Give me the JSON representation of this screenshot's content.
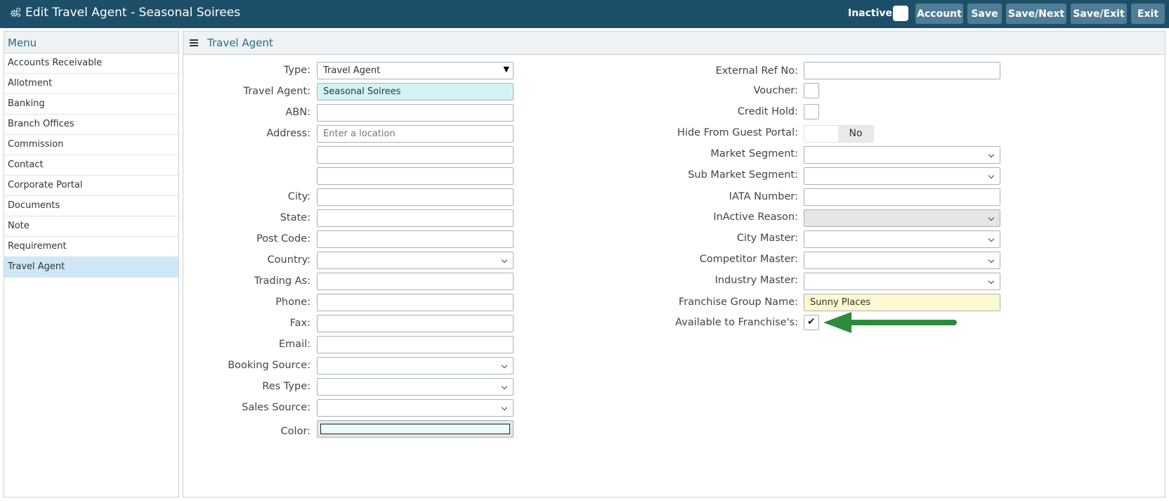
{
  "header": {
    "title": "Edit Travel Agent - Seasonal Soirees",
    "inactive_label": "Inactive",
    "buttons": {
      "account": "Account",
      "save": "Save",
      "save_next": "Save/Next",
      "save_exit": "Save/Exit",
      "exit": "Exit"
    }
  },
  "sidebar": {
    "title": "Menu",
    "items": [
      {
        "label": "Accounts Receivable"
      },
      {
        "label": "Allotment"
      },
      {
        "label": "Banking"
      },
      {
        "label": "Branch Offices"
      },
      {
        "label": "Commission"
      },
      {
        "label": "Contact"
      },
      {
        "label": "Corporate Portal"
      },
      {
        "label": "Documents"
      },
      {
        "label": "Note"
      },
      {
        "label": "Requirement"
      },
      {
        "label": "Travel Agent",
        "active": true
      }
    ]
  },
  "panel": {
    "title": "Travel Agent"
  },
  "left_form": {
    "type": {
      "label": "Type:",
      "value": "Travel Agent"
    },
    "travel_agent": {
      "label": "Travel Agent:",
      "value": "Seasonal Soirees"
    },
    "abn": {
      "label": "ABN:",
      "value": ""
    },
    "address": {
      "label": "Address:",
      "placeholder": "Enter a location"
    },
    "city": {
      "label": "City:",
      "value": ""
    },
    "state": {
      "label": "State:",
      "value": ""
    },
    "post_code": {
      "label": "Post Code:",
      "value": ""
    },
    "country": {
      "label": "Country:",
      "value": ""
    },
    "trading_as": {
      "label": "Trading As:",
      "value": ""
    },
    "phone": {
      "label": "Phone:",
      "value": ""
    },
    "fax": {
      "label": "Fax:",
      "value": ""
    },
    "email": {
      "label": "Email:",
      "value": ""
    },
    "booking_source": {
      "label": "Booking Source:",
      "value": ""
    },
    "res_type": {
      "label": "Res Type:",
      "value": ""
    },
    "sales_source": {
      "label": "Sales Source:",
      "value": ""
    },
    "color": {
      "label": "Color:",
      "value": "#ecfafa"
    }
  },
  "right_form": {
    "external_ref": {
      "label": "External Ref No:",
      "value": ""
    },
    "voucher": {
      "label": "Voucher:",
      "checked": false
    },
    "credit_hold": {
      "label": "Credit Hold:",
      "checked": false
    },
    "hide_portal": {
      "label": "Hide From Guest Portal:",
      "value": "No"
    },
    "market_segment": {
      "label": "Market Segment:",
      "value": ""
    },
    "sub_market_segment": {
      "label": "Sub Market Segment:",
      "value": ""
    },
    "iata": {
      "label": "IATA Number:",
      "value": ""
    },
    "inactive_reason": {
      "label": "InActive Reason:",
      "value": ""
    },
    "city_master": {
      "label": "City Master:",
      "value": ""
    },
    "competitor_master": {
      "label": "Competitor Master:",
      "value": ""
    },
    "industry_master": {
      "label": "Industry Master:",
      "value": ""
    },
    "franchise_group": {
      "label": "Franchise Group Name:",
      "value": "Sunny Places"
    },
    "available_franchise": {
      "label": "Available to Franchise's:",
      "checked": true,
      "mark": "✔"
    }
  },
  "colors": {
    "header_bg": "#1e4f68",
    "button_bg": "#4f7d97",
    "accent": "#2a6b8c",
    "arrow": "#2e8b3a"
  }
}
